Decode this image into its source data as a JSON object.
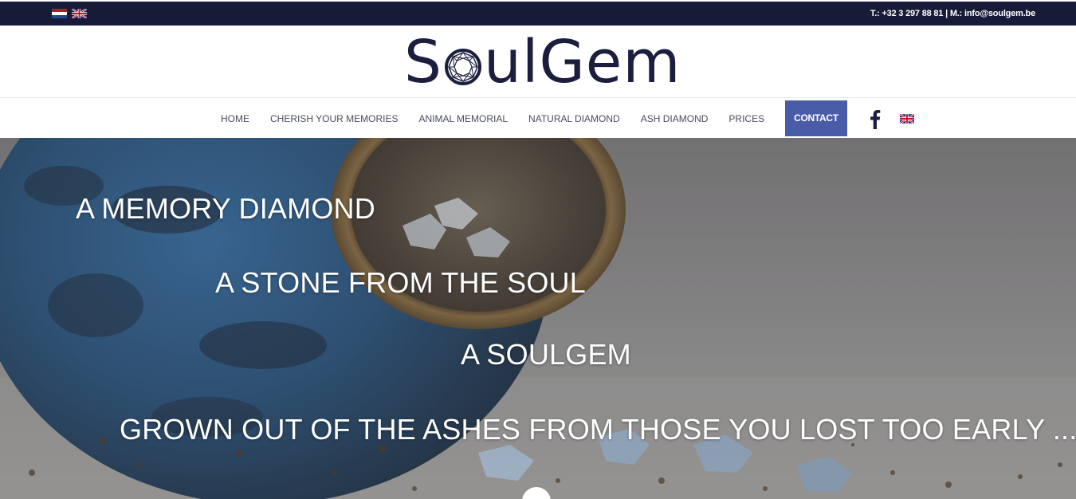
{
  "topbar": {
    "phone_label": "T.:",
    "phone": "+32 3 297 88 81",
    "separator": "|",
    "mail_label": "M.:",
    "email": "info@soulgem.be",
    "flags": [
      "netherlands-flag-icon",
      "uk-flag-icon"
    ]
  },
  "logo": {
    "part1": "S",
    "part2": "ulGem",
    "color": "#1b1e3d"
  },
  "nav": {
    "items": [
      {
        "label": "HOME"
      },
      {
        "label": "CHERISH YOUR MEMORIES"
      },
      {
        "label": "ANIMAL MEMORIAL"
      },
      {
        "label": "NATURAL DIAMOND"
      },
      {
        "label": "ASH DIAMOND"
      },
      {
        "label": "PRICES"
      }
    ],
    "contact": "CONTACT",
    "contact_color": "#4a5ba8",
    "social_icon": "facebook-icon",
    "language_icon": "uk-flag-icon"
  },
  "hero": {
    "lines": [
      "A MEMORY DIAMOND",
      "A STONE FROM THE SOUL",
      "A SOULGEM",
      "GROWN OUT OF THE ASHES FROM THOSE YOU LOST TOO EARLY ..."
    ]
  }
}
